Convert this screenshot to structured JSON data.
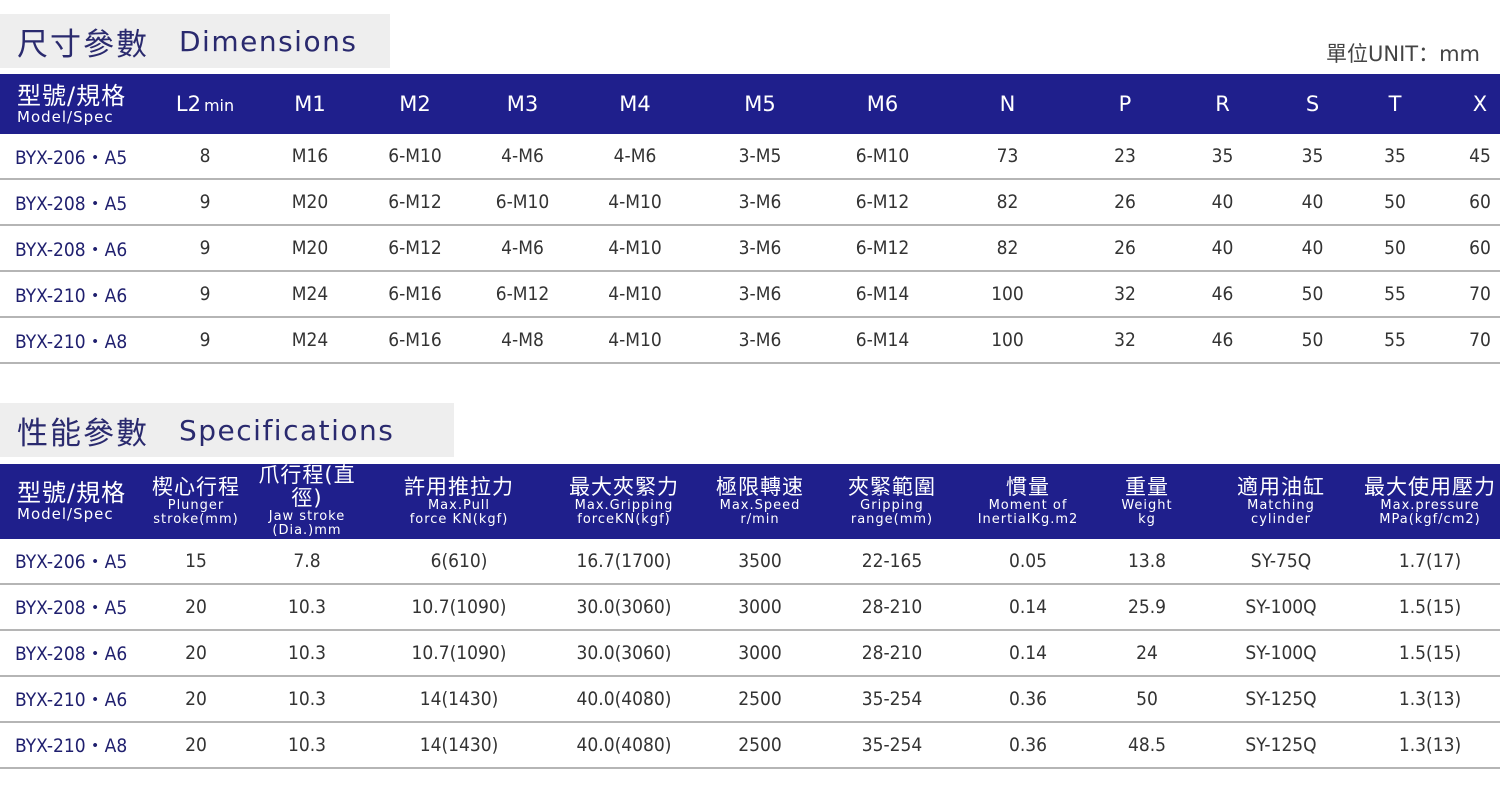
{
  "dimensions": {
    "title_cn": "尺寸參數",
    "title_en": "Dimensions",
    "unit": "單位UNIT：mm",
    "header": {
      "model_cn": "型號/規格",
      "model_en": "Model/Spec",
      "l2": "L2",
      "l2_sub": "min",
      "cols": [
        "M1",
        "M2",
        "M3",
        "M4",
        "M5",
        "M6",
        "N",
        "P",
        "R",
        "S",
        "T",
        "X"
      ]
    },
    "rows": [
      {
        "model": "BYX-206・A5",
        "cells": [
          "8",
          "M16",
          "6-M10",
          "4-M6",
          "4-M6",
          "3-M5",
          "6-M10",
          "73",
          "23",
          "35",
          "35",
          "35",
          "45"
        ]
      },
      {
        "model": "BYX-208・A5",
        "cells": [
          "9",
          "M20",
          "6-M12",
          "6-M10",
          "4-M10",
          "3-M6",
          "6-M12",
          "82",
          "26",
          "40",
          "40",
          "50",
          "60"
        ]
      },
      {
        "model": "BYX-208・A6",
        "cells": [
          "9",
          "M20",
          "6-M12",
          "4-M6",
          "4-M10",
          "3-M6",
          "6-M12",
          "82",
          "26",
          "40",
          "40",
          "50",
          "60"
        ]
      },
      {
        "model": "BYX-210・A6",
        "cells": [
          "9",
          "M24",
          "6-M16",
          "6-M12",
          "4-M10",
          "3-M6",
          "6-M14",
          "100",
          "32",
          "46",
          "50",
          "55",
          "70"
        ]
      },
      {
        "model": "BYX-210・A8",
        "cells": [
          "9",
          "M24",
          "6-M16",
          "4-M8",
          "4-M10",
          "3-M6",
          "6-M14",
          "100",
          "32",
          "46",
          "50",
          "55",
          "70"
        ]
      }
    ]
  },
  "specifications": {
    "title_cn": "性能參數",
    "title_en": "Specifications",
    "header": {
      "model_cn": "型號/規格",
      "model_en": "Model/Spec",
      "cols": [
        {
          "cn": "楔心行程",
          "en1": "Plunger",
          "en2": "stroke(mm)"
        },
        {
          "cn": "爪行程(直徑)",
          "en1": "Jaw stroke",
          "en2": "(Dia.)mm"
        },
        {
          "cn": "許用推拉力",
          "en1": "Max.Pull",
          "en2": "force KN(kgf)"
        },
        {
          "cn": "最大夾緊力",
          "en1": "Max.Gripping",
          "en2": "forceKN(kgf)"
        },
        {
          "cn": "極限轉速",
          "en1": "Max.Speed",
          "en2": "r/min"
        },
        {
          "cn": "夾緊範圍",
          "en1": "Gripping",
          "en2": "range(mm)"
        },
        {
          "cn": "慣量",
          "en1": "Moment of",
          "en2": "InertialKg.m2"
        },
        {
          "cn": "重量",
          "en1": "Weight",
          "en2": "kg"
        },
        {
          "cn": "適用油缸",
          "en1": "Matching",
          "en2": "cylinder"
        },
        {
          "cn": "最大使用壓力",
          "en1": "Max.pressure",
          "en2": "MPa(kgf/cm2)"
        }
      ]
    },
    "rows": [
      {
        "model": "BYX-206・A5",
        "cells": [
          "15",
          "7.8",
          "6(610)",
          "16.7(1700)",
          "3500",
          "22-165",
          "0.05",
          "13.8",
          "SY-75Q",
          "1.7(17)"
        ]
      },
      {
        "model": "BYX-208・A5",
        "cells": [
          "20",
          "10.3",
          "10.7(1090)",
          "30.0(3060)",
          "3000",
          "28-210",
          "0.14",
          "25.9",
          "SY-100Q",
          "1.5(15)"
        ]
      },
      {
        "model": "BYX-208・A6",
        "cells": [
          "20",
          "10.3",
          "10.7(1090)",
          "30.0(3060)",
          "3000",
          "28-210",
          "0.14",
          "24",
          "SY-100Q",
          "1.5(15)"
        ]
      },
      {
        "model": "BYX-210・A6",
        "cells": [
          "20",
          "10.3",
          "14(1430)",
          "40.0(4080)",
          "2500",
          "35-254",
          "0.36",
          "50",
          "SY-125Q",
          "1.3(13)"
        ]
      },
      {
        "model": "BYX-210・A8",
        "cells": [
          "20",
          "10.3",
          "14(1430)",
          "40.0(4080)",
          "2500",
          "35-254",
          "0.36",
          "48.5",
          "SY-125Q",
          "1.3(13)"
        ]
      }
    ]
  },
  "colors": {
    "header_bg": "#1f1f8c",
    "title_bg": "#eeeeee",
    "title_text": "#2a2a6e",
    "model_text": "#1f1f6e",
    "row_border": "#b5b5b5"
  }
}
